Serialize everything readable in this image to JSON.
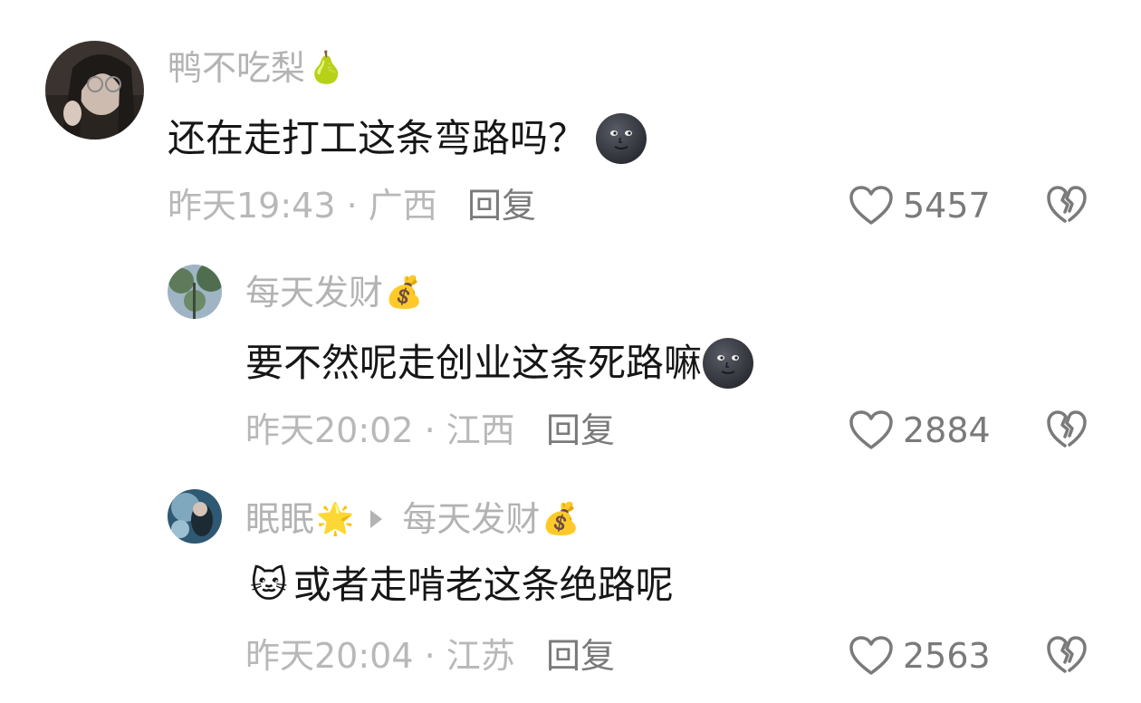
{
  "comments": [
    {
      "username": "鸭不吃梨",
      "username_emoji": "🍐",
      "text": "还在走打工这条弯路吗？",
      "time": "昨天19:43",
      "separator": " · ",
      "location": "广西",
      "reply_label": "回复",
      "likes": "5457"
    },
    {
      "username": "每天发财",
      "username_emoji": "💰",
      "text": "要不然呢走创业这条死路嘛",
      "time": "昨天20:02",
      "separator": " · ",
      "location": "江西",
      "reply_label": "回复",
      "likes": "2884"
    },
    {
      "username": "眠眠",
      "username_emoji": "🌟",
      "reply_to": "每天发财",
      "reply_to_emoji": "💰",
      "leading_emoji": "🐱",
      "text": "或者走啃老这条绝路呢",
      "time": "昨天20:04",
      "separator": " · ",
      "location": "江苏",
      "reply_label": "回复",
      "likes": "2563"
    }
  ],
  "icons": {
    "like": "heart-outline-icon",
    "dislike": "broken-heart-icon",
    "moon": "new-moon-face-emoji"
  },
  "colors": {
    "username": "#b3b3b3",
    "content": "#161616",
    "meta": "#b8b8b8",
    "action": "#7a7a7a"
  }
}
